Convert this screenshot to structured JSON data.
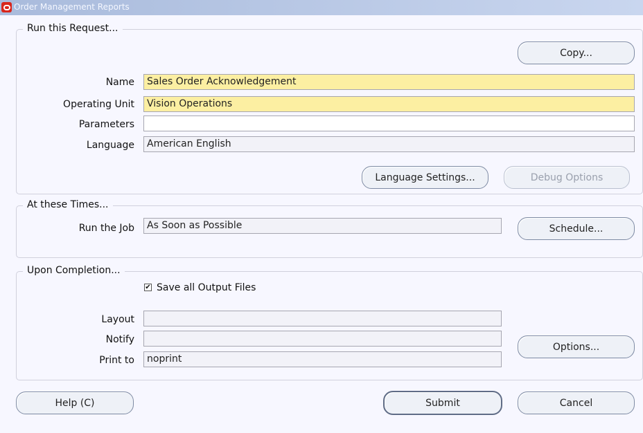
{
  "window": {
    "title": "Order Management Reports"
  },
  "run_request": {
    "group_title": "Run this Request...",
    "copy_button": "Copy...",
    "name_label": "Name",
    "name_value": "Sales Order Acknowledgement",
    "operating_unit_label": "Operating Unit",
    "operating_unit_value": "Vision Operations",
    "parameters_label": "Parameters",
    "parameters_value": "",
    "language_label": "Language",
    "language_value": "American English",
    "language_settings_button": "Language Settings...",
    "debug_options_button": "Debug Options"
  },
  "at_times": {
    "group_title": "At these Times...",
    "run_job_label": "Run the Job",
    "run_job_value": "As Soon as Possible",
    "schedule_button": "Schedule..."
  },
  "completion": {
    "group_title": "Upon Completion...",
    "save_output_label": "Save all Output Files",
    "save_output_checked": true,
    "layout_label": "Layout",
    "layout_value": "",
    "notify_label": "Notify",
    "notify_value": "",
    "print_to_label": "Print to",
    "print_to_value": "noprint",
    "options_button": "Options..."
  },
  "footer": {
    "help_button": "Help (C)",
    "submit_button": "Submit",
    "cancel_button": "Cancel"
  },
  "colors": {
    "required_field": "#fcefa2",
    "titlebar": "#a9bbdc",
    "background": "#f7f7ff"
  }
}
